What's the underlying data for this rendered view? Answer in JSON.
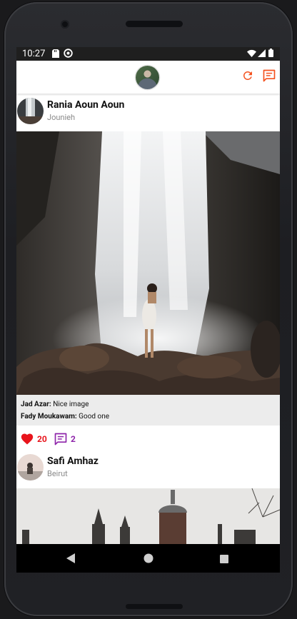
{
  "status_bar": {
    "time": "10:27",
    "icons": [
      "sd-card-icon",
      "sync-icon",
      "wifi-icon",
      "cellular-icon",
      "battery-icon"
    ]
  },
  "app_bar": {
    "center_avatar": "profile-avatar",
    "actions": [
      "refresh-icon",
      "message-icon"
    ],
    "accent_color": "#f4511e"
  },
  "posts": [
    {
      "author": "Rania Aoun Aoun",
      "location": "Jounieh",
      "image": "waterfall-photo",
      "comments": [
        {
          "user": "Jad Azar:",
          "text": " Nice image"
        },
        {
          "user": "Fady Moukawam:",
          "text": " Good one"
        }
      ],
      "likes": "20",
      "comment_count": "2",
      "like_color": "#e8141c",
      "comment_color": "#8e24aa"
    },
    {
      "author": "Safi Amhaz",
      "location": "Beirut",
      "image": "city-towers-photo"
    }
  ],
  "nav_bar": {
    "buttons": [
      "back-icon",
      "home-icon",
      "recents-icon"
    ]
  }
}
